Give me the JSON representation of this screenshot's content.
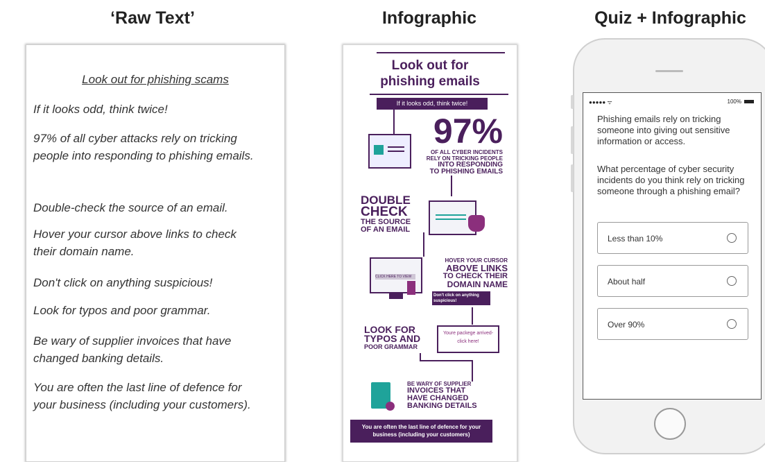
{
  "titles": {
    "raw": "‘Raw Text’",
    "infographic": "Infographic",
    "quiz": "Quiz + Infographic"
  },
  "raw": {
    "heading": "Look out for phishing scams",
    "lines": [
      "If it looks odd, think twice!",
      "97% of all cyber attacks rely on tricking people into responding to phishing emails.",
      "Double-check the source of an email.",
      "Hover your cursor above links to check their domain name.",
      "Don't click on anything suspicious!",
      "Look for typos and poor grammar.",
      "Be wary of supplier invoices that have changed banking details.",
      "You are often the last line of defence for your business (including your customers)."
    ]
  },
  "infographic": {
    "title_line1": "Look out for",
    "title_line2": "phishing emails",
    "banner": "If it looks odd, think twice!",
    "percent": "97%",
    "percent_caption1": "OF ALL CYBER INCIDENTS",
    "percent_caption2": "RELY ON TRICKING PEOPLE",
    "percent_caption3": "INTO RESPONDING",
    "percent_caption4": "TO PHISHING EMAILS",
    "double1": "DOUBLE",
    "double2": "CHECK",
    "double3": "THE SOURCE",
    "double4": "OF AN EMAIL",
    "hover1": "HOVER YOUR CURSOR",
    "hover2": "ABOVE LINKS",
    "hover3": "TO CHECK THEIR",
    "hover4": "DOMAIN NAME",
    "dont_click": "Don't click on anything suspicious!",
    "click_here": "CLICK HERE TO VIEW",
    "look1": "LOOK FOR",
    "look2": "TYPOS AND",
    "look3": "POOR GRAMMAR",
    "typo_line1": "Youre packege arrived-",
    "typo_line2": "click here!",
    "wary1": "BE WARY OF SUPPLIER",
    "wary2": "INVOICES THAT",
    "wary3": "HAVE CHANGED",
    "wary4": "BANKING DETAILS",
    "footer": "You are often the last line of defence for your business (including your customers)"
  },
  "phone": {
    "signal": "●●●●● ᯤ",
    "battery": "100%",
    "intro": "Phishing emails rely on tricking someone into giving out sensitive information or access.",
    "question": "What percentage of cyber security incidents do you think rely on tricking someone through a phishing email?",
    "options": [
      "Less than 10%",
      "About half",
      "Over 90%"
    ]
  }
}
